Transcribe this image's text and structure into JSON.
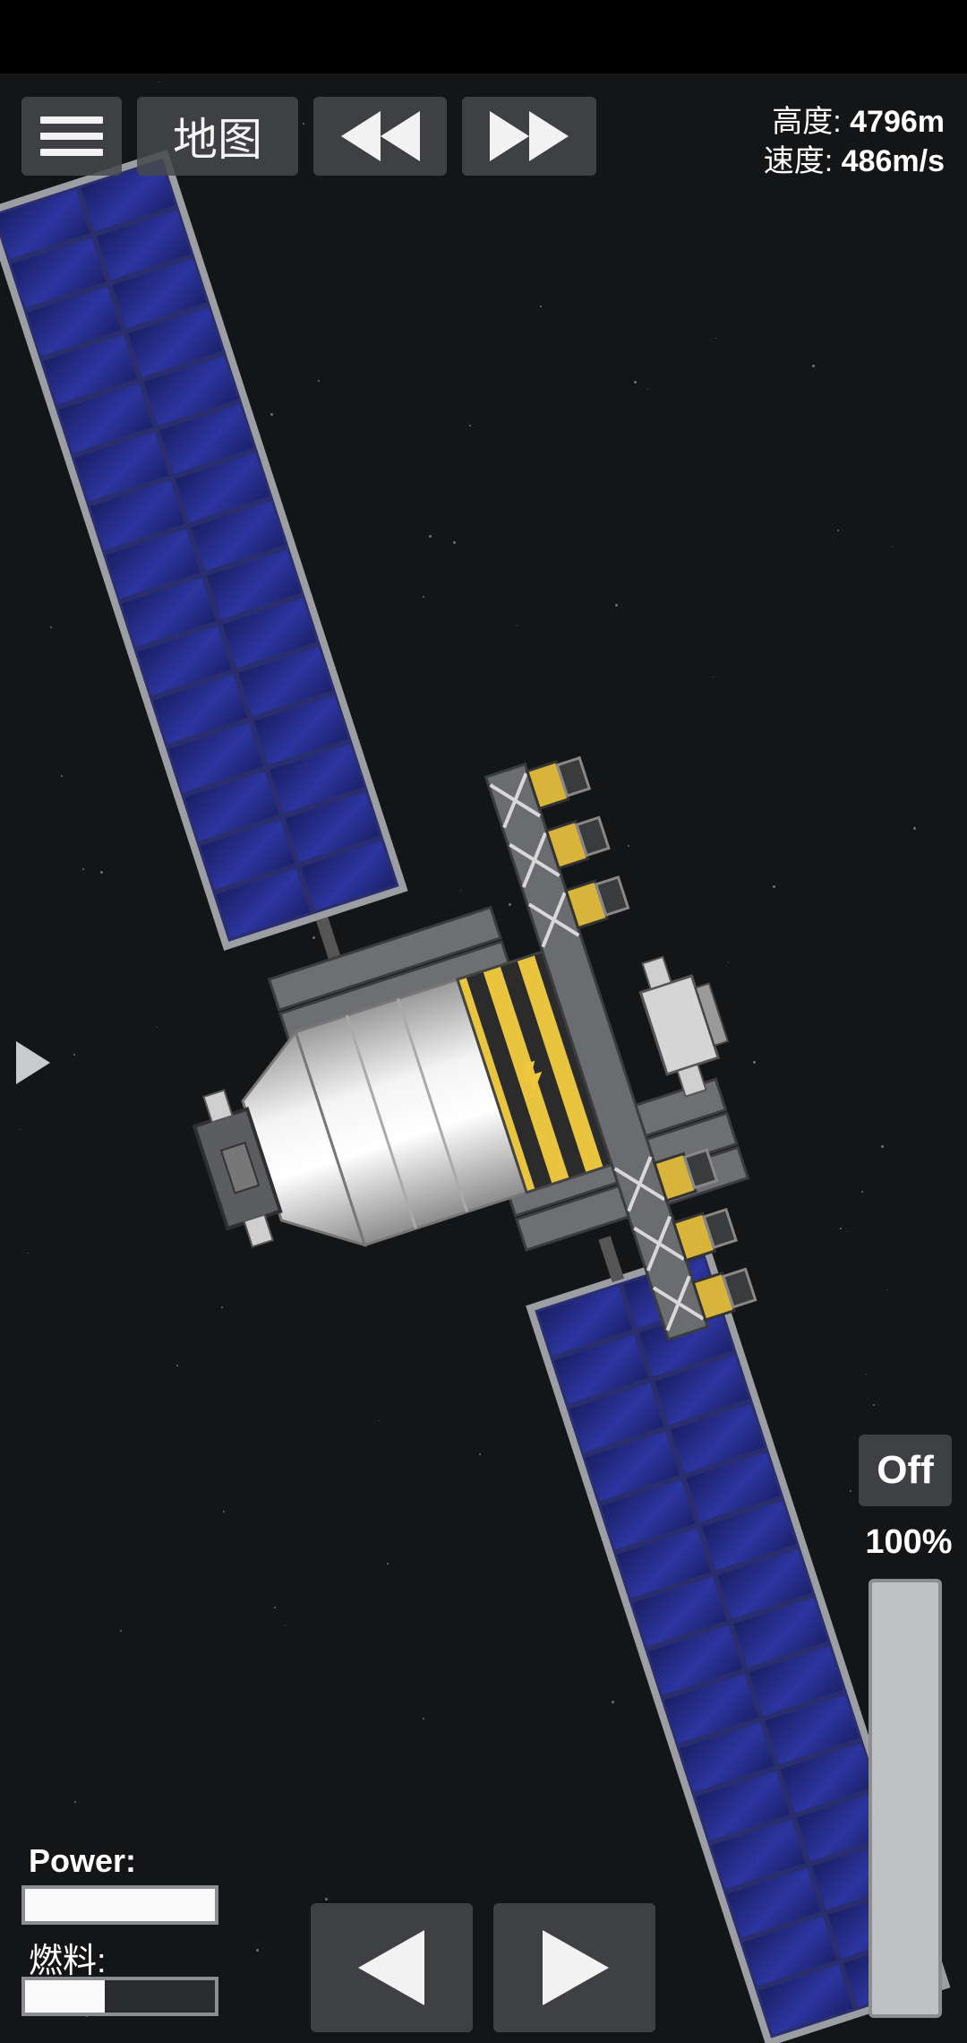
{
  "hud": {
    "map_label": "地图",
    "altitude_label": "高度:",
    "altitude_value": "4796m",
    "speed_label": "速度:",
    "speed_value": "486m/s"
  },
  "resources": {
    "power_label": "Power:",
    "power_level": 1.0,
    "fuel_label": "燃料:",
    "fuel_level": 0.42
  },
  "throttle": {
    "toggle_label": "Off",
    "percent_label": "100%",
    "level": 1.0
  },
  "icons": {
    "menu": "hamburger-icon",
    "rewind": "rewind-icon",
    "fast_forward": "fast-forward-icon",
    "turn_left": "triangle-left-icon",
    "turn_right": "triangle-right-icon"
  },
  "colors": {
    "panel_blue": "#23297a",
    "hull_white": "#e4e4e4",
    "warning_yellow": "#f1c73e"
  }
}
